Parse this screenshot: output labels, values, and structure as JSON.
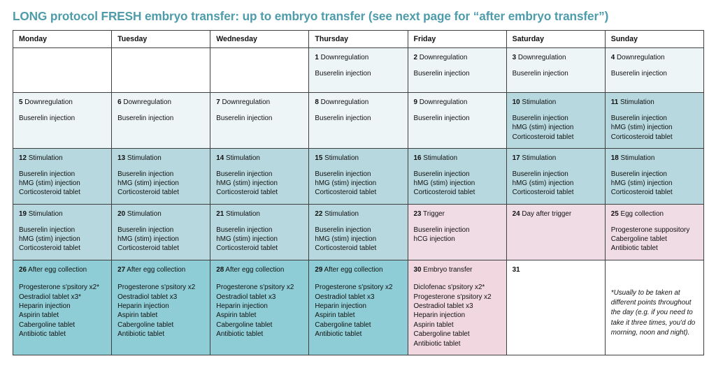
{
  "header": {
    "title": "LONG protocol FRESH embryo transfer: up to embryo transfer (see next page for “after embryo transfer”)",
    "title_color": "#4e9cab"
  },
  "colors": {
    "blank": "#ffffff",
    "downregulation": "#eef5f6",
    "stimulation": "#b6d8de",
    "trigger": "#f0dce4",
    "after_egg_collection": "#8ecdd6",
    "embryo_transfer": "#f0d7e0",
    "border": "#3f3f3f"
  },
  "calendar": {
    "columns": [
      "Monday",
      "Tuesday",
      "Wednesday",
      "Thursday",
      "Friday",
      "Saturday",
      "Sunday"
    ],
    "rows": [
      [
        {
          "num": "",
          "label": "",
          "meds": [],
          "phase": "blank"
        },
        {
          "num": "",
          "label": "",
          "meds": [],
          "phase": "blank"
        },
        {
          "num": "",
          "label": "",
          "meds": [],
          "phase": "blank"
        },
        {
          "num": "1",
          "label": "Downregulation",
          "meds": [
            "Buserelin injection"
          ],
          "phase": "downreg"
        },
        {
          "num": "2",
          "label": "Downregulation",
          "meds": [
            "Buserelin injection"
          ],
          "phase": "downreg"
        },
        {
          "num": "3",
          "label": "Downregulation",
          "meds": [
            "Buserelin injection"
          ],
          "phase": "downreg"
        },
        {
          "num": "4",
          "label": "Downregulation",
          "meds": [
            "Buserelin injection"
          ],
          "phase": "downreg"
        }
      ],
      [
        {
          "num": "5",
          "label": "Downregulation",
          "meds": [
            "Buserelin injection"
          ],
          "phase": "downreg"
        },
        {
          "num": "6",
          "label": "Downregulation",
          "meds": [
            "Buserelin injection"
          ],
          "phase": "downreg"
        },
        {
          "num": "7",
          "label": "Downregulation",
          "meds": [
            "Buserelin injection"
          ],
          "phase": "downreg"
        },
        {
          "num": "8",
          "label": "Downregulation",
          "meds": [
            "Buserelin injection"
          ],
          "phase": "downreg"
        },
        {
          "num": "9",
          "label": "Downregulation",
          "meds": [
            "Buserelin injection"
          ],
          "phase": "downreg"
        },
        {
          "num": "10",
          "label": "Stimulation",
          "meds": [
            "Buserelin injection",
            "hMG (stim) injection",
            "Corticosteroid tablet"
          ],
          "phase": "stim"
        },
        {
          "num": "11",
          "label": "Stimulation",
          "meds": [
            "Buserelin injection",
            "hMG (stim) injection",
            "Corticosteroid tablet"
          ],
          "phase": "stim"
        }
      ],
      [
        {
          "num": "12",
          "label": "Stimulation",
          "meds": [
            "Buserelin injection",
            "hMG (stim) injection",
            "Corticosteroid tablet"
          ],
          "phase": "stim"
        },
        {
          "num": "13",
          "label": "Stimulation",
          "meds": [
            "Buserelin injection",
            "hMG (stim) injection",
            "Corticosteroid tablet"
          ],
          "phase": "stim"
        },
        {
          "num": "14",
          "label": "Stimulation",
          "meds": [
            "Buserelin injection",
            "hMG (stim) injection",
            "Corticosteroid tablet"
          ],
          "phase": "stim"
        },
        {
          "num": "15",
          "label": "Stimulation",
          "meds": [
            "Buserelin injection",
            "hMG (stim) injection",
            "Corticosteroid tablet"
          ],
          "phase": "stim"
        },
        {
          "num": "16",
          "label": "Stimulation",
          "meds": [
            "Buserelin injection",
            "hMG (stim) injection",
            "Corticosteroid tablet"
          ],
          "phase": "stim"
        },
        {
          "num": "17",
          "label": "Stimulation",
          "meds": [
            "Buserelin injection",
            "hMG (stim) injection",
            "Corticosteroid tablet"
          ],
          "phase": "stim"
        },
        {
          "num": "18",
          "label": "Stimulation",
          "meds": [
            "Buserelin injection",
            "hMG (stim) injection",
            "Corticosteroid tablet"
          ],
          "phase": "stim"
        }
      ],
      [
        {
          "num": "19",
          "label": "Stimulation",
          "meds": [
            "Buserelin injection",
            "hMG (stim) injection",
            "Corticosteroid tablet"
          ],
          "phase": "stim"
        },
        {
          "num": "20",
          "label": "Stimulation",
          "meds": [
            "Buserelin injection",
            "hMG (stim) injection",
            "Corticosteroid tablet"
          ],
          "phase": "stim"
        },
        {
          "num": "21",
          "label": "Stimulation",
          "meds": [
            "Buserelin injection",
            "hMG (stim) injection",
            "Corticosteroid tablet"
          ],
          "phase": "stim"
        },
        {
          "num": "22",
          "label": "Stimulation",
          "meds": [
            "Buserelin injection",
            "hMG (stim) injection",
            "Corticosteroid tablet"
          ],
          "phase": "stim"
        },
        {
          "num": "23",
          "label": "Trigger",
          "meds": [
            "Buserelin injection",
            "hCG injection"
          ],
          "phase": "trigger"
        },
        {
          "num": "24",
          "label": "Day after trigger",
          "meds": [],
          "phase": "trigger"
        },
        {
          "num": "25",
          "label": "Egg collection",
          "meds": [
            "Progesterone suppository",
            "Cabergoline tablet",
            "Antibiotic tablet"
          ],
          "phase": "trigger"
        }
      ],
      [
        {
          "num": "26",
          "label": "After egg collection",
          "meds": [
            "Progesterone s'psitory x2*",
            "Oestradiol tablet x3*",
            "Heparin injection",
            "Aspirin tablet",
            "Cabergoline tablet",
            "Antibiotic tablet"
          ],
          "phase": "aftercoll"
        },
        {
          "num": "27",
          "label": "After egg collection",
          "meds": [
            "Progesterone s'psitory x2",
            "Oestradiol tablet x3",
            "Heparin injection",
            "Aspirin tablet",
            "Cabergoline tablet",
            "Antibiotic tablet"
          ],
          "phase": "aftercoll"
        },
        {
          "num": "28",
          "label": "After egg collection",
          "meds": [
            "Progesterone s'psitory x2",
            "Oestradiol tablet x3",
            "Heparin injection",
            "Aspirin tablet",
            "Cabergoline tablet",
            "Antibiotic tablet"
          ],
          "phase": "aftercoll"
        },
        {
          "num": "29",
          "label": "After egg collection",
          "meds": [
            "Progesterone s'psitory x2",
            "Oestradiol tablet x3",
            "Heparin injection",
            "Aspirin tablet",
            "Cabergoline tablet",
            "Antibiotic tablet"
          ],
          "phase": "aftercoll"
        },
        {
          "num": "30",
          "label": "Embryo transfer",
          "meds": [
            "Diclofenac s'psitory x2*",
            "Progesterone s'psitory x2",
            "Oestradiol tablet x3",
            "Heparin injection",
            "Aspirin tablet",
            "Cabergoline tablet",
            "Antibiotic tablet"
          ],
          "phase": "transfer"
        },
        {
          "num": "31",
          "label": "",
          "meds": [],
          "phase": "plain"
        },
        {
          "num": "",
          "label": "",
          "meds": [],
          "phase": "note",
          "footnote": "*Usually to be taken at different points throughout the day (e.g. if you need to take it three times, you'd do morning, noon and night)."
        }
      ]
    ]
  }
}
